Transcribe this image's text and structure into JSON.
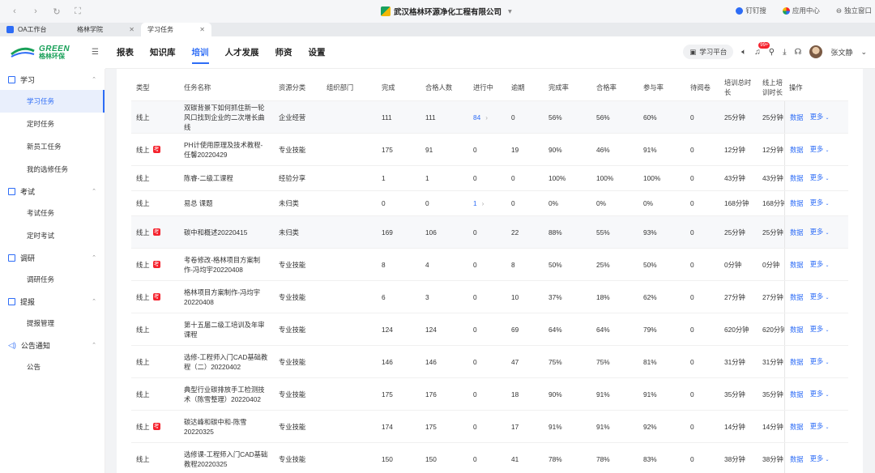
{
  "browser": {
    "company": "武汉格林环源净化工程有限公司",
    "right_items": [
      "钉钉搜",
      "应用中心",
      "独立窗口"
    ],
    "tabs": [
      {
        "label": "OA工作台"
      },
      {
        "label": "格林学院"
      },
      {
        "label": "学习任务"
      }
    ]
  },
  "logo": {
    "en": "GREEN",
    "cn": "格林环保"
  },
  "topnav": {
    "items": [
      "报表",
      "知识库",
      "培训",
      "人才发展",
      "师资",
      "设置"
    ],
    "platform_label": "学习平台",
    "badge": "99+",
    "user": "张文静"
  },
  "sidebar": {
    "groups": [
      {
        "label": "学习",
        "items": [
          "学习任务",
          "定时任务",
          "新员工任务",
          "我的选修任务"
        ]
      },
      {
        "label": "考试",
        "items": [
          "考试任务",
          "定时考试"
        ]
      },
      {
        "label": "调研",
        "items": [
          "调研任务"
        ]
      },
      {
        "label": "提报",
        "items": [
          "提报管理"
        ]
      },
      {
        "label": "公告通知",
        "items": [
          "公告"
        ]
      }
    ]
  },
  "table": {
    "headers": [
      "类型",
      "任务名称",
      "资源分类",
      "组织部门",
      "完成",
      "合格人数",
      "进行中",
      "逾期",
      "完成率",
      "合格率",
      "参与率",
      "待阅卷",
      "培训总时长",
      "线上培训时长",
      "操作"
    ],
    "exam_tag": "考",
    "op_data": "数据",
    "op_more": "更多",
    "rows": [
      {
        "type": "线上",
        "exam": false,
        "name": "双碳背景下如何抓住新一轮风口找到企业的二次增长曲线",
        "cat": "企业经营",
        "done": "111",
        "pass": "111",
        "prog": "84",
        "prog_link": true,
        "late": "0",
        "r1": "56%",
        "r2": "56%",
        "r3": "60%",
        "wait": "0",
        "t1": "25分钟",
        "t2": "25分钟"
      },
      {
        "type": "线上",
        "exam": true,
        "name": "PH计使用原理及技术教程-任馨20220429",
        "cat": "专业技能",
        "done": "175",
        "pass": "91",
        "prog": "0",
        "prog_link": false,
        "late": "19",
        "r1": "90%",
        "r2": "46%",
        "r3": "91%",
        "wait": "0",
        "t1": "12分钟",
        "t2": "12分钟"
      },
      {
        "type": "线上",
        "exam": false,
        "name": "陈睿-二级工课程",
        "cat": "经验分享",
        "done": "1",
        "pass": "1",
        "prog": "0",
        "prog_link": false,
        "late": "0",
        "r1": "100%",
        "r2": "100%",
        "r3": "100%",
        "wait": "0",
        "t1": "43分钟",
        "t2": "43分钟"
      },
      {
        "type": "线上",
        "exam": false,
        "name": "易总 课题",
        "cat": "未归类",
        "done": "0",
        "pass": "0",
        "prog": "1",
        "prog_link": true,
        "late": "0",
        "r1": "0%",
        "r2": "0%",
        "r3": "0%",
        "wait": "0",
        "t1": "168分钟",
        "t2": "168分钟"
      },
      {
        "type": "线上",
        "exam": true,
        "name": "碳中和概述20220415",
        "cat": "未归类",
        "done": "169",
        "pass": "106",
        "prog": "0",
        "prog_link": false,
        "late": "22",
        "r1": "88%",
        "r2": "55%",
        "r3": "93%",
        "wait": "0",
        "t1": "25分钟",
        "t2": "25分钟"
      },
      {
        "type": "线上",
        "exam": true,
        "name": "考卷修改-格林项目方案制作-冯均宇20220408",
        "cat": "专业技能",
        "done": "8",
        "pass": "4",
        "prog": "0",
        "prog_link": false,
        "late": "8",
        "r1": "50%",
        "r2": "25%",
        "r3": "50%",
        "wait": "0",
        "t1": "0分钟",
        "t2": "0分钟"
      },
      {
        "type": "线上",
        "exam": true,
        "name": "格林项目方案制作-冯均宇20220408",
        "cat": "专业技能",
        "done": "6",
        "pass": "3",
        "prog": "0",
        "prog_link": false,
        "late": "10",
        "r1": "37%",
        "r2": "18%",
        "r3": "62%",
        "wait": "0",
        "t1": "27分钟",
        "t2": "27分钟"
      },
      {
        "type": "线上",
        "exam": false,
        "name": "第十五届二级工培训及年审课程",
        "cat": "专业技能",
        "done": "124",
        "pass": "124",
        "prog": "0",
        "prog_link": false,
        "late": "69",
        "r1": "64%",
        "r2": "64%",
        "r3": "79%",
        "wait": "0",
        "t1": "620分钟",
        "t2": "620分钟"
      },
      {
        "type": "线上",
        "exam": false,
        "name": "选修-工程师入门CAD基础教程（二）20220402",
        "cat": "专业技能",
        "done": "146",
        "pass": "146",
        "prog": "0",
        "prog_link": false,
        "late": "47",
        "r1": "75%",
        "r2": "75%",
        "r3": "81%",
        "wait": "0",
        "t1": "31分钟",
        "t2": "31分钟"
      },
      {
        "type": "线上",
        "exam": false,
        "name": "典型行业碳排放手工检测技术（陈雪整理）20220402",
        "cat": "专业技能",
        "done": "175",
        "pass": "176",
        "prog": "0",
        "prog_link": false,
        "late": "18",
        "r1": "90%",
        "r2": "91%",
        "r3": "91%",
        "wait": "0",
        "t1": "35分钟",
        "t2": "35分钟"
      },
      {
        "type": "线上",
        "exam": true,
        "name": "碳达峰和碳中和-陈雪20220325",
        "cat": "专业技能",
        "done": "174",
        "pass": "175",
        "prog": "0",
        "prog_link": false,
        "late": "17",
        "r1": "91%",
        "r2": "91%",
        "r3": "92%",
        "wait": "0",
        "t1": "14分钟",
        "t2": "14分钟"
      },
      {
        "type": "线上",
        "exam": false,
        "name": "选修课-工程师入门CAD基础教程20220325",
        "cat": "专业技能",
        "done": "150",
        "pass": "150",
        "prog": "0",
        "prog_link": false,
        "late": "41",
        "r1": "78%",
        "r2": "78%",
        "r3": "83%",
        "wait": "0",
        "t1": "38分钟",
        "t2": "38分钟"
      }
    ]
  }
}
